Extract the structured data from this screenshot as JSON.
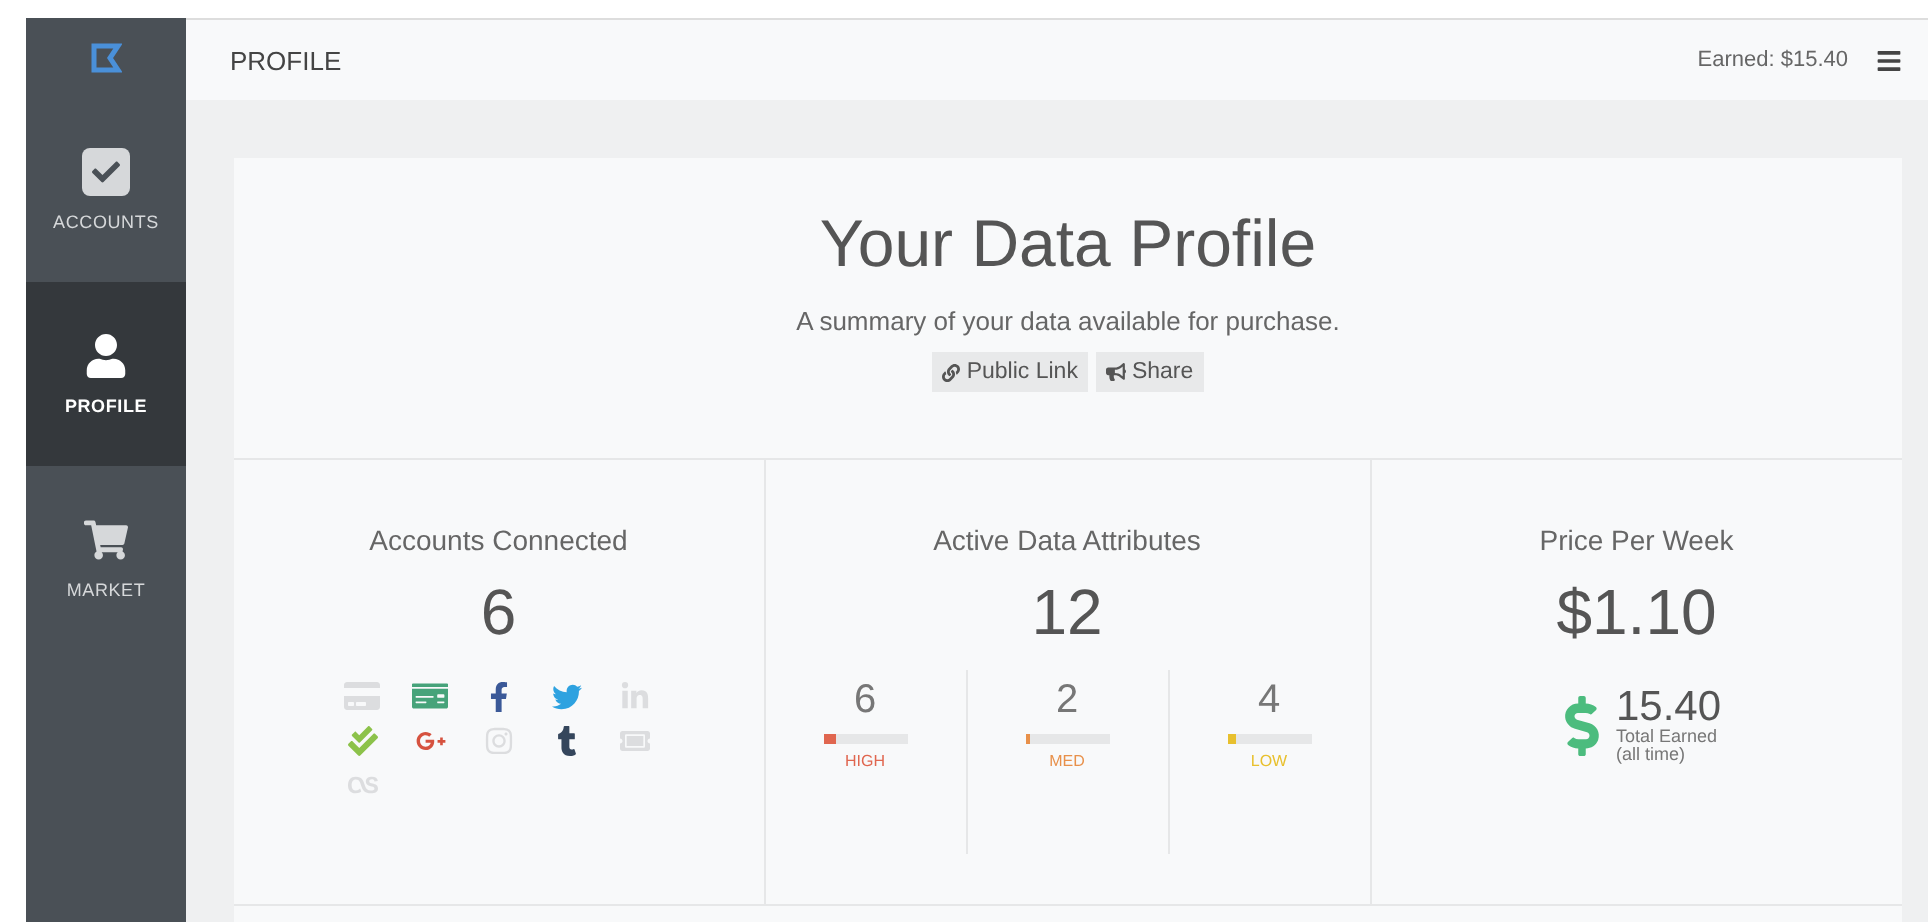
{
  "sidebar": {
    "items": [
      {
        "label": "ACCOUNTS",
        "kind": "check",
        "selected": false
      },
      {
        "label": "PROFILE",
        "kind": "user",
        "selected": true
      },
      {
        "label": "MARKET",
        "kind": "cart",
        "selected": false
      }
    ]
  },
  "topbar": {
    "title": "PROFILE",
    "earned": "Earned: $15.40"
  },
  "profile": {
    "title": "Your Data Profile",
    "subtitle": "A summary of your data available for purchase.",
    "actions": [
      {
        "label": "Public Link",
        "kind": "link"
      },
      {
        "label": "Share",
        "kind": "share"
      }
    ]
  },
  "accounts": {
    "title": "Accounts Connected",
    "count": "6",
    "services": [
      {
        "kind": "card",
        "connected": false
      },
      {
        "kind": "bank",
        "connected": true
      },
      {
        "kind": "facebook",
        "connected": true
      },
      {
        "kind": "twitter",
        "connected": true
      },
      {
        "kind": "linkedin",
        "connected": false
      },
      {
        "kind": "check",
        "connected": true
      },
      {
        "kind": "googleplus",
        "connected": true
      },
      {
        "kind": "instagram",
        "connected": false
      },
      {
        "kind": "tumblr",
        "connected": true
      },
      {
        "kind": "ticket",
        "connected": false
      },
      {
        "kind": "lastfm",
        "connected": false
      }
    ]
  },
  "attributes": {
    "title": "Active Data Attributes",
    "count": "12",
    "levels": [
      {
        "value": "6",
        "label": "HIGH",
        "level": 0.15,
        "color": "#e0664f"
      },
      {
        "value": "2",
        "label": "MED",
        "level": 0.05,
        "color": "#e8904a"
      },
      {
        "value": "4",
        "label": "LOW",
        "level": 0.1,
        "color": "#e8c02e"
      }
    ]
  },
  "price": {
    "title": "Price Per Week",
    "value": "$1.10",
    "total": "15.40",
    "total_label": "Total Earned",
    "total_note": "(all time)"
  }
}
